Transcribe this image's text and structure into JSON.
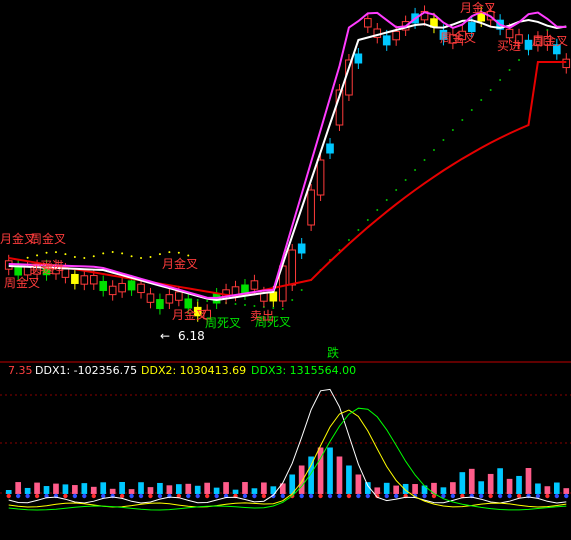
{
  "chart_data": {
    "type": "candlestick",
    "colors": {
      "background": "#000000",
      "up_candle": "#ff3b3b",
      "down_candle": "#00c8ff",
      "down_candle_alt": "#00e000",
      "yellow_candle": "#ffff00",
      "ma_white": "#ffffff",
      "ma_magenta": "#ff3cff",
      "ma_red": "#e60000",
      "sar_dots": "#00c000",
      "divider": "#c00000",
      "ddx_label": "#ff4040",
      "ddx1_text": "#ffffff",
      "ddx2_text": "#ffff00",
      "ddx3_text": "#00ff00"
    },
    "annotations": [
      {
        "text": "月金叉",
        "color": "#ff3c3c"
      },
      {
        "text": "周金叉",
        "color": "#ff3c3c"
      },
      {
        "text": "买进",
        "color": "#ff3c3c"
      },
      {
        "text": "周死叉",
        "color": "#00e000"
      },
      {
        "text": "6.18",
        "color": "#ffffff"
      },
      {
        "text": "周金叉",
        "color": "#ff3c3c"
      },
      {
        "text": "买进",
        "color": "#ff3c3c"
      },
      {
        "text": "月金叉",
        "color": "#ff3c3c"
      },
      {
        "text": "月金叉",
        "color": "#ff3c3c"
      },
      {
        "text": "卖出",
        "color": "#ff3c3c"
      },
      {
        "text": "周死叉",
        "color": "#00e000"
      },
      {
        "text": "月金叉",
        "color": "#ff3c3c"
      },
      {
        "text": "周金叉",
        "color": "#ff3c3c"
      },
      {
        "text": "买进",
        "color": "#ff3c3c"
      },
      {
        "text": "周金叉",
        "color": "#ff3c3c"
      }
    ],
    "price_min_label": "6.18",
    "divider_label": "跌",
    "ddx": {
      "prefix": "7.35",
      "ddx1_label": "DDX1: -102356.75",
      "ddx2_label": "DDX2: 1030413.69",
      "ddx3_label": "DDX3: 1315564.00"
    }
  }
}
